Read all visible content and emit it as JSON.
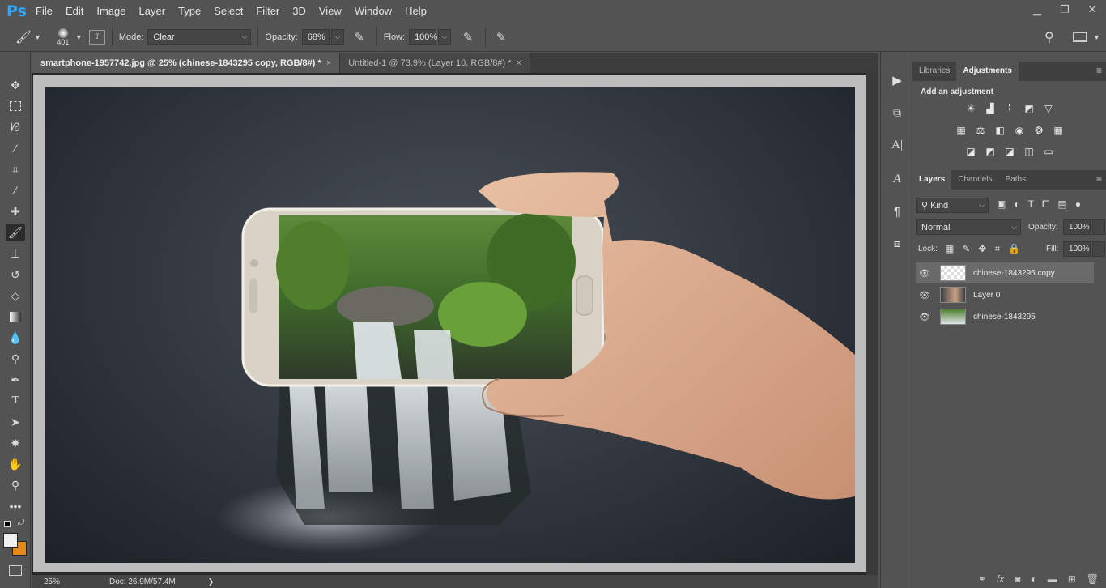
{
  "app": {
    "logo": "Ps"
  },
  "menu": [
    "File",
    "Edit",
    "Image",
    "Layer",
    "Type",
    "Select",
    "Filter",
    "3D",
    "View",
    "Window",
    "Help"
  ],
  "window_controls": {
    "minimize": "▁",
    "restore": "❐",
    "close": "✕"
  },
  "options": {
    "brush_size": "401",
    "mode_label": "Mode:",
    "mode_value": "Clear",
    "opacity_label": "Opacity:",
    "opacity_value": "68%",
    "flow_label": "Flow:",
    "flow_value": "100%"
  },
  "tabs": [
    {
      "label": "smartphone-1957742.jpg @ 25% (chinese-1843295 copy, RGB/8#) *",
      "close": "×"
    },
    {
      "label": "Untitled-1 @ 73.9% (Layer 10, RGB/8#) *",
      "close": "×"
    }
  ],
  "status": {
    "zoom": "25%",
    "doc": "Doc: 26.9M/57.4M",
    "arrow": "❯"
  },
  "panels": {
    "top_tabs": [
      "Libraries",
      "Adjustments"
    ],
    "add_adjustment": "Add an adjustment",
    "layers_tabs": [
      "Layers",
      "Channels",
      "Paths"
    ],
    "kind_label": "Kind",
    "blend_mode": "Normal",
    "opacity_label": "Opacity:",
    "opacity_value": "100%",
    "lock_label": "Lock:",
    "fill_label": "Fill:",
    "fill_value": "100%",
    "layers": [
      {
        "name": "chinese-1843295 copy",
        "selected": true
      },
      {
        "name": "Layer 0",
        "selected": false
      },
      {
        "name": "chinese-1843295",
        "selected": false
      }
    ]
  },
  "colors": {
    "accent": "#31a8ff",
    "foreground": "#f0f0f0",
    "background": "#e38a1c"
  }
}
